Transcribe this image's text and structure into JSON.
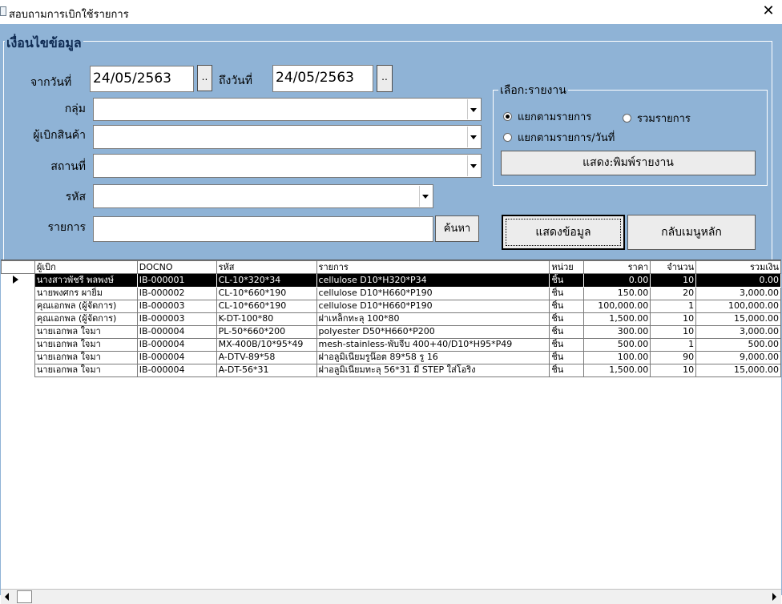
{
  "window": {
    "title": "สอบถามการเบิกใช้รายการ",
    "close_glyph": "✕"
  },
  "criteria": {
    "legend": "เงื่อนไขข้อมูล",
    "from_label": "จากวันที่",
    "from_value": "24/05/2563",
    "to_label": "ถึงวันที่",
    "to_value": "24/05/2563",
    "date_button": "..",
    "group_label": "กลุ่ม",
    "group_value": "",
    "requester_label": "ผู้เบิกสินค้า",
    "requester_value": "",
    "location_label": "สถานที่",
    "location_value": "",
    "code_label": "รหัส",
    "code_value": "",
    "item_label": "รายการ",
    "item_value": "",
    "search_button": "ค้นหา"
  },
  "report": {
    "legend": "เลือก:รายงาน",
    "option_by_item": "แยกตามรายการ",
    "option_total": "รวมรายการ",
    "option_by_item_date": "แยกตามรายการ/วันที่",
    "selected": "by_item",
    "print_button": "แสดง:พิมพ์รายงาน"
  },
  "actions": {
    "show_data": "แสดงข้อมูล",
    "back_menu": "กลับเมนูหลัก"
  },
  "grid": {
    "columns": [
      "ผู้เบิก",
      "DOCNO",
      "รหัส",
      "รายการ",
      "หน่วย",
      "ราคา",
      "จำนวน",
      "รวมเงิน"
    ],
    "rows": [
      [
        "นางสาวพัชรี พลพงษ์",
        "IB-000001",
        "CL-10*320*34",
        "cellulose D10*H320*P34",
        "ชิ้น",
        "0.00",
        "10",
        "0.00"
      ],
      [
        "นายพงศกร ผายิ้ม",
        "IB-000002",
        "CL-10*660*190",
        "cellulose D10*H660*P190",
        "ชิ้น",
        "150.00",
        "20",
        "3,000.00"
      ],
      [
        "คุณเอกพล (ผู้จัดการ)",
        "IB-000003",
        "CL-10*660*190",
        "cellulose D10*H660*P190",
        "ชิ้น",
        "100,000.00",
        "1",
        "100,000.00"
      ],
      [
        "คุณเอกพล (ผู้จัดการ)",
        "IB-000003",
        "K-DT-100*80",
        "ฝาเหล็กทะลุ 100*80",
        "ชิ้น",
        "1,500.00",
        "10",
        "15,000.00"
      ],
      [
        "นายเอกพล ใจมา",
        "IB-000004",
        "PL-50*660*200",
        "polyester D50*H660*P200",
        "ชิ้น",
        "300.00",
        "10",
        "3,000.00"
      ],
      [
        "นายเอกพล ใจมา",
        "IB-000004",
        "MX-400B/10*95*49",
        "mesh-stainless-พับจีบ 400+40/D10*H95*P49",
        "ชิ้น",
        "500.00",
        "1",
        "500.00"
      ],
      [
        "นายเอกพล ใจมา",
        "IB-000004",
        "A-DTV-89*58",
        "ฝาอลูมิเนียมรูน๊อต 89*58 รู 16",
        "ชิ้น",
        "100.00",
        "90",
        "9,000.00"
      ],
      [
        "นายเอกพล ใจมา",
        "IB-000004",
        "A-DT-56*31",
        "ฝาอลูมิเนียมทะลุ 56*31 มี STEP ใส่โอริง",
        "ชิ้น",
        "1,500.00",
        "10",
        "15,000.00"
      ]
    ],
    "selected_row": 0
  },
  "colors": {
    "form_bg": "#8fb3d6",
    "legend_text": "#0e2a52",
    "selection": "#000000"
  }
}
